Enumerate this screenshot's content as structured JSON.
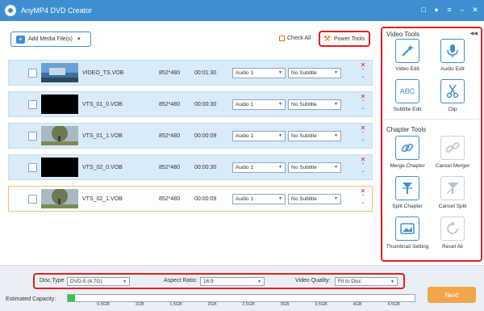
{
  "app": {
    "title": "AnyMP4 DVD Creator"
  },
  "toolbar": {
    "add_media_label": "Add Media File(s)",
    "check_all_label": "Check All",
    "power_tools_label": "Power Tools"
  },
  "rows": [
    {
      "filename": "VIDEO_TS.VOB",
      "resolution": "852*480",
      "duration": "00:01:30",
      "audio": "Audio 1",
      "subtitle": "No Subtitle",
      "thumb": "landscape"
    },
    {
      "filename": "VTS_01_0.VOB",
      "resolution": "852*480",
      "duration": "00:00:30",
      "audio": "Audio 1",
      "subtitle": "No Subtitle",
      "thumb": "black"
    },
    {
      "filename": "VTS_01_1.VOB",
      "resolution": "852*480",
      "duration": "00:00:09",
      "audio": "Audio 1",
      "subtitle": "No Subtitle",
      "thumb": "tree"
    },
    {
      "filename": "VTS_02_0.VOB",
      "resolution": "852*480",
      "duration": "00:00:30",
      "audio": "Audio 1",
      "subtitle": "No Subtitle",
      "thumb": "black"
    },
    {
      "filename": "VTS_02_1.VOB",
      "resolution": "852*480",
      "duration": "00:00:09",
      "audio": "Audio 1",
      "subtitle": "No Subtitle",
      "thumb": "tree"
    }
  ],
  "video_tools": {
    "heading": "Video Tools",
    "items": [
      {
        "label": "Video Edit",
        "icon": "magic-wand-icon"
      },
      {
        "label": "Audio Edit",
        "icon": "microphone-icon"
      },
      {
        "label": "Subtitle Edit",
        "icon": "abc-icon"
      },
      {
        "label": "Clip",
        "icon": "scissors-icon"
      }
    ]
  },
  "chapter_tools": {
    "heading": "Chapter Tools",
    "items": [
      {
        "label": "Merge Chapter",
        "icon": "link-icon"
      },
      {
        "label": "Cancel Merger",
        "icon": "unlink-icon"
      },
      {
        "label": "Split Chapter",
        "icon": "split-icon"
      },
      {
        "label": "Cancel Split",
        "icon": "cancel-split-icon"
      },
      {
        "label": "Thumbnail Setting",
        "icon": "thumbnail-icon"
      },
      {
        "label": "Reset All",
        "icon": "reset-icon"
      }
    ]
  },
  "settings": {
    "disc_type_label": "Disc Type",
    "disc_type_value": "DVD-5 (4.7G)",
    "aspect_ratio_label": "Aspect Ratio:",
    "aspect_ratio_value": "16:9",
    "video_quality_label": "Video Quality:",
    "video_quality_value": "Fit to Disc"
  },
  "capacity": {
    "label": "Estimated Capacity:",
    "used_fraction": 0.02,
    "ticks": [
      "0.5GB",
      "1GB",
      "1.5GB",
      "2GB",
      "2.5GB",
      "3GB",
      "3.5GB",
      "4GB",
      "4.5GB"
    ]
  },
  "next_label": "Next",
  "colors": {
    "accent": "#3f8fd0",
    "highlight": "#e32020",
    "next": "#f3a54a",
    "capacity_fill": "#37c44b"
  }
}
